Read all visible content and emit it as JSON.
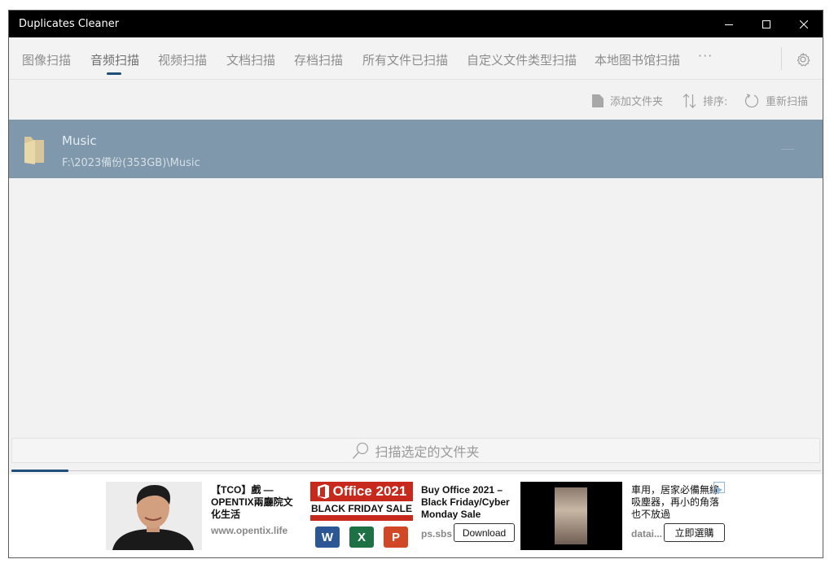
{
  "window": {
    "title": "Duplicates Cleaner"
  },
  "tabs": [
    {
      "label": "图像扫描",
      "active": false
    },
    {
      "label": "音频扫描",
      "active": true
    },
    {
      "label": "视频扫描",
      "active": false
    },
    {
      "label": "文档扫描",
      "active": false
    },
    {
      "label": "存档扫描",
      "active": false
    },
    {
      "label": "所有文件已扫描",
      "active": false
    },
    {
      "label": "自定义文件类型扫描",
      "active": false
    },
    {
      "label": "本地图书馆扫描",
      "active": false
    }
  ],
  "more_label": "···",
  "toolbar": {
    "add_folder": "添加文件夹",
    "sort": "排序:",
    "rescan": "重新扫描"
  },
  "folder": {
    "name": "Music",
    "path": "F:\\2023備份(353GB)\\Music"
  },
  "scan_button": {
    "label": "扫描选定的文件夹"
  },
  "progress": {
    "fraction": 0.07
  },
  "ads": [
    {
      "title": "【TCO】戲 — OPENTIX兩廳院文化生活",
      "source": "www.opentix.life"
    },
    {
      "banner_title": "Office 2021",
      "banner_sub": "BLACK FRIDAY SALE",
      "title": "Buy Office 2021 – Black Friday/Cyber Monday Sale",
      "source": "ps.sbs",
      "button": "Download"
    },
    {
      "title": "車用，居家必備無線吸塵器，再小的角落也不放過",
      "source": "datai...",
      "button": "立即選購"
    }
  ],
  "colors": {
    "titlebar": "#000000",
    "accent": "#1f4e79",
    "selected_row": "#7f98ab",
    "office_red": "#c72a1d"
  }
}
